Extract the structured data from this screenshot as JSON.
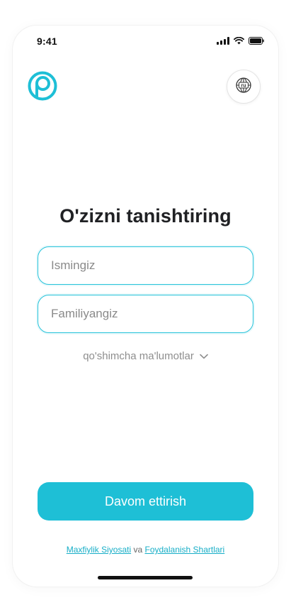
{
  "status_bar": {
    "time": "9:41"
  },
  "header": {
    "logo_icon": "brand-logo-icon",
    "language_icon": "globe-icon",
    "language_code": "ru"
  },
  "main": {
    "title": "O'zizni tanishtiring",
    "first_name_placeholder": "Ismingiz",
    "last_name_placeholder": "Familiyangiz",
    "more_info_label": "qo'shimcha ma'lumotlar",
    "more_info_icon": "chevron-down-icon"
  },
  "footer": {
    "continue_label": "Davom ettirish",
    "privacy_link": "Maxfiylik Siyosati",
    "connector": "va",
    "terms_link": "Foydalanish Shartlari"
  },
  "colors": {
    "accent": "#1ebfd6",
    "text": "#202124"
  }
}
